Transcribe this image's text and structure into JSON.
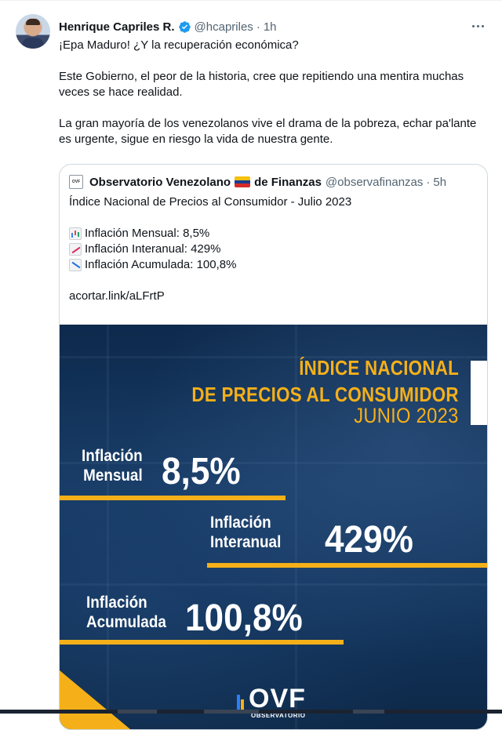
{
  "tweet": {
    "display_name": "Henrique Capriles R.",
    "handle": "@hcapriles",
    "separator": "·",
    "time": "1h",
    "paragraphs": [
      "¡Epa Maduro! ¿Y la recuperación económica?",
      "Este Gobierno, el peor de la historia, cree que repitiendo una mentira muchas veces se hace realidad.",
      "La gran mayoría de los venezolanos vive el drama de la pobreza, echar pa'lante es urgente, sigue en riesgo la vida de nuestra gente."
    ],
    "icons": {
      "verified": "verified-badge-icon",
      "more": "more-options-icon"
    },
    "accent_color": "#1d9bf0"
  },
  "quote": {
    "name_part1": "Observatorio Venezolano",
    "name_part2": "de Finanzas",
    "handle": "@observafinanzas",
    "separator": "·",
    "time": "5h",
    "lines": {
      "title": "Índice Nacional de Precios al Consumidor - Julio 2023",
      "mensual": "Inflación Mensual: 8,5%",
      "interanual": "Inflación Interanual: 429%",
      "acumulada": "Inflación Acumulada: 100,8%",
      "link": "acortar.link/aLFrtP"
    },
    "icons": {
      "avatar": "ovf-avatar-icon",
      "flag": "venezuela-flag-icon",
      "mensual": "bar-chart-icon",
      "interanual": "chart-increasing-icon",
      "acumulada": "chart-decreasing-icon"
    },
    "avatar_text": "OVF",
    "flag_colors": [
      "#f4c20d",
      "#1a3c8f",
      "#d62a2a"
    ]
  },
  "media": {
    "title_line1": "ÍNDICE NACIONAL",
    "title_line2": "DE PRECIOS AL CONSUMIDOR",
    "title_line3": "JUNIO 2023",
    "mensual_label_1": "Inflación",
    "mensual_label_2": "Mensual",
    "mensual_value": "8,5%",
    "interanual_label_1": "Inflación",
    "interanual_label_2": "Interanual",
    "interanual_value": "429%",
    "acumulada_label_1": "Inflación",
    "acumulada_label_2": "Acumulada",
    "acumulada_value": "100,8%",
    "logo_text": "OVF",
    "logo_subtext": "OBSERVATORIO",
    "colors": {
      "accent": "#f5b019",
      "background": "#12345c"
    }
  }
}
